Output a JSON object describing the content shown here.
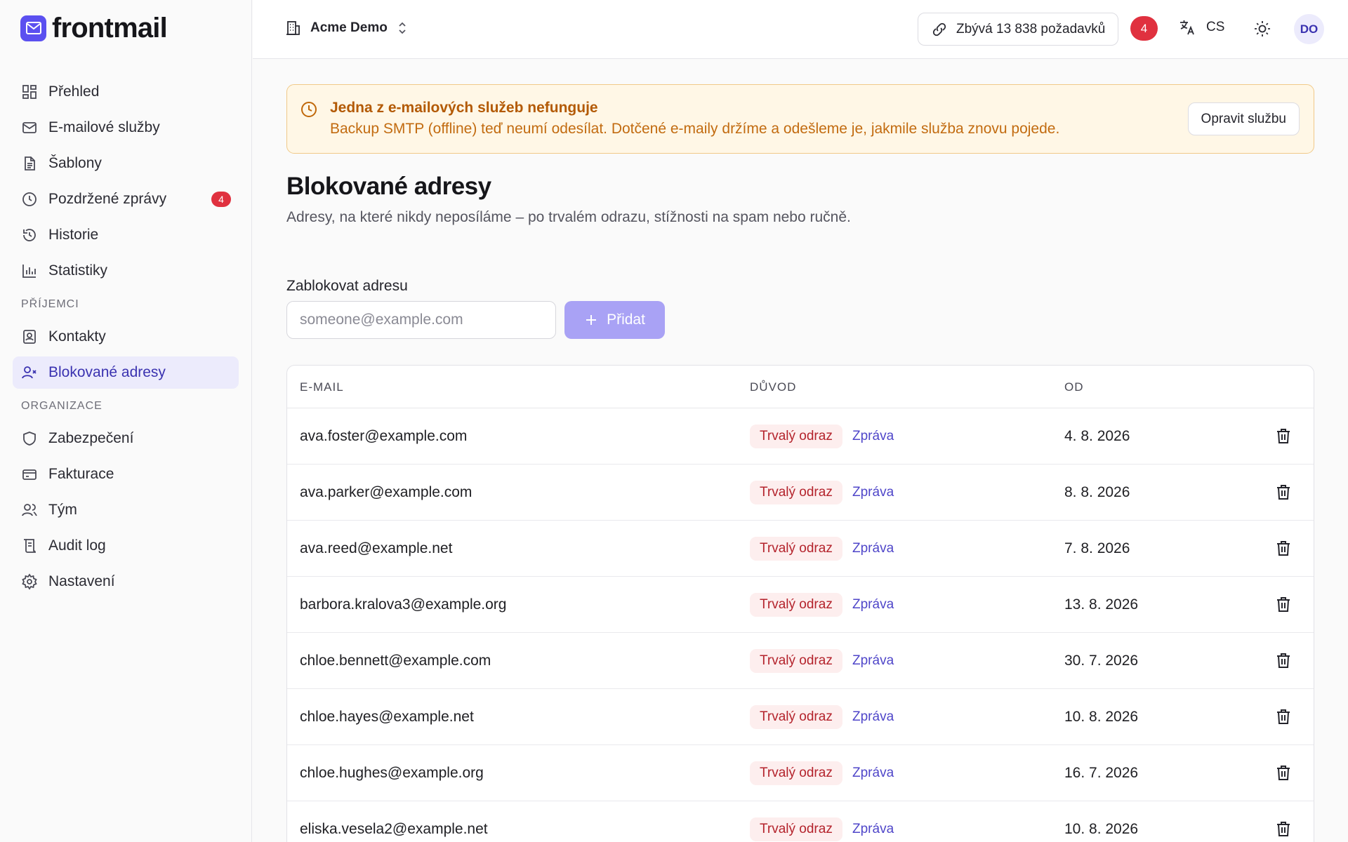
{
  "brand": {
    "name": "frontmail",
    "accent": "#5b50f0"
  },
  "sidebar": {
    "items": [
      {
        "label": "Přehled",
        "icon": "dashboard-icon"
      },
      {
        "label": "E-mailové služby",
        "icon": "mail-icon"
      },
      {
        "label": "Šablony",
        "icon": "document-icon"
      },
      {
        "label": "Pozdržené zprávy",
        "icon": "clock-icon",
        "badge": "4"
      },
      {
        "label": "Historie",
        "icon": "history-icon"
      },
      {
        "label": "Statistiky",
        "icon": "chart-icon"
      }
    ],
    "section_recipients": "PŘÍJEMCI",
    "recipients": [
      {
        "label": "Kontakty",
        "icon": "contact-card-icon"
      },
      {
        "label": "Blokované adresy",
        "icon": "user-blocked-icon",
        "active": true
      }
    ],
    "section_org": "ORGANIZACE",
    "org": [
      {
        "label": "Zabezpečení",
        "icon": "shield-icon"
      },
      {
        "label": "Fakturace",
        "icon": "credit-card-icon"
      },
      {
        "label": "Tým",
        "icon": "team-icon"
      },
      {
        "label": "Audit log",
        "icon": "scroll-icon"
      },
      {
        "label": "Nastavení",
        "icon": "gear-icon"
      }
    ]
  },
  "topbar": {
    "org_name": "Acme Demo",
    "quota": "Zbývá 13 838 požadavků",
    "notifications": "4",
    "lang": "CS",
    "avatar": "DO"
  },
  "alert": {
    "title": "Jedna z e-mailových služeb nefunguje",
    "text": "Backup SMTP (offline) teď neumí odesílat. Dotčené e-maily držíme a odešleme je, jakmile služba znovu pojede.",
    "button": "Opravit službu"
  },
  "page": {
    "title": "Blokované adresy",
    "subtitle": "Adresy, na které nikdy neposíláme – po trvalém odrazu, stížnosti na spam nebo ručně."
  },
  "form": {
    "label": "Zablokovat adresu",
    "placeholder": "someone@example.com",
    "value": "",
    "add_label": "Přidat"
  },
  "table": {
    "headers": {
      "email": "E-MAIL",
      "reason": "DŮVOD",
      "since": "OD"
    },
    "rows": [
      {
        "email": "ava.foster@example.com",
        "reason": "Trvalý odraz",
        "link": "Zpráva",
        "since": "4. 8. 2026"
      },
      {
        "email": "ava.parker@example.com",
        "reason": "Trvalý odraz",
        "link": "Zpráva",
        "since": "8. 8. 2026"
      },
      {
        "email": "ava.reed@example.net",
        "reason": "Trvalý odraz",
        "link": "Zpráva",
        "since": "7. 8. 2026"
      },
      {
        "email": "barbora.kralova3@example.org",
        "reason": "Trvalý odraz",
        "link": "Zpráva",
        "since": "13. 8. 2026"
      },
      {
        "email": "chloe.bennett@example.com",
        "reason": "Trvalý odraz",
        "link": "Zpráva",
        "since": "30. 7. 2026"
      },
      {
        "email": "chloe.hayes@example.net",
        "reason": "Trvalý odraz",
        "link": "Zpráva",
        "since": "10. 8. 2026"
      },
      {
        "email": "chloe.hughes@example.org",
        "reason": "Trvalý odraz",
        "link": "Zpráva",
        "since": "16. 7. 2026"
      },
      {
        "email": "eliska.vesela2@example.net",
        "reason": "Trvalý odraz",
        "link": "Zpráva",
        "since": "10. 8. 2026"
      }
    ]
  }
}
